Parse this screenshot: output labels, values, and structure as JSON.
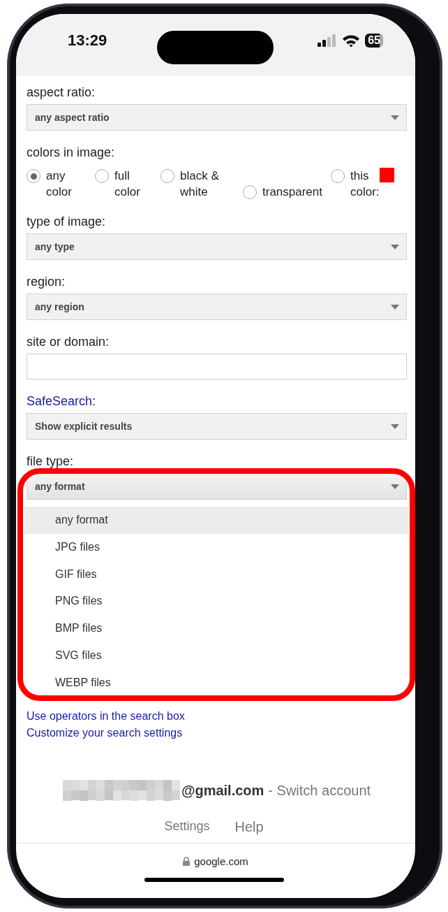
{
  "status_bar": {
    "time": "13:29",
    "battery": "65"
  },
  "fields": [
    {
      "kind": "select",
      "label": "aspect ratio:",
      "value": "any aspect ratio"
    },
    {
      "kind": "radios",
      "label": "colors in image:",
      "options": [
        {
          "label": "any color",
          "selected": true
        },
        {
          "label": "full color",
          "selected": false
        },
        {
          "label": "black & white",
          "selected": false
        },
        {
          "label": "transparent",
          "selected": false
        },
        {
          "label": "this color:",
          "selected": false,
          "color": "#ff0000"
        }
      ]
    },
    {
      "kind": "select",
      "label": "type of image:",
      "value": "any type"
    },
    {
      "kind": "select",
      "label": "region:",
      "value": "any region"
    },
    {
      "kind": "text",
      "label": "site or domain:"
    },
    {
      "kind": "select",
      "label_link": "SafeSearch",
      "label": ":",
      "value": "Show explicit results"
    },
    {
      "kind": "select",
      "label": "file type:",
      "value": "any format",
      "open": true,
      "options": [
        {
          "label": "any format",
          "selected": true
        },
        {
          "label": "JPG files",
          "selected": false
        },
        {
          "label": "GIF files",
          "selected": false
        },
        {
          "label": "PNG files",
          "selected": false
        },
        {
          "label": "BMP files",
          "selected": false
        },
        {
          "label": "SVG files",
          "selected": false
        },
        {
          "label": "WEBP files",
          "selected": false
        }
      ]
    }
  ],
  "links": [
    "Use operators in the search box",
    "Customize your search settings"
  ],
  "account": {
    "email": "@gmail.com",
    "action": "- Switch account"
  },
  "footer_links": [
    "Settings",
    "Help"
  ],
  "address_bar": {
    "domain": "google.com"
  }
}
